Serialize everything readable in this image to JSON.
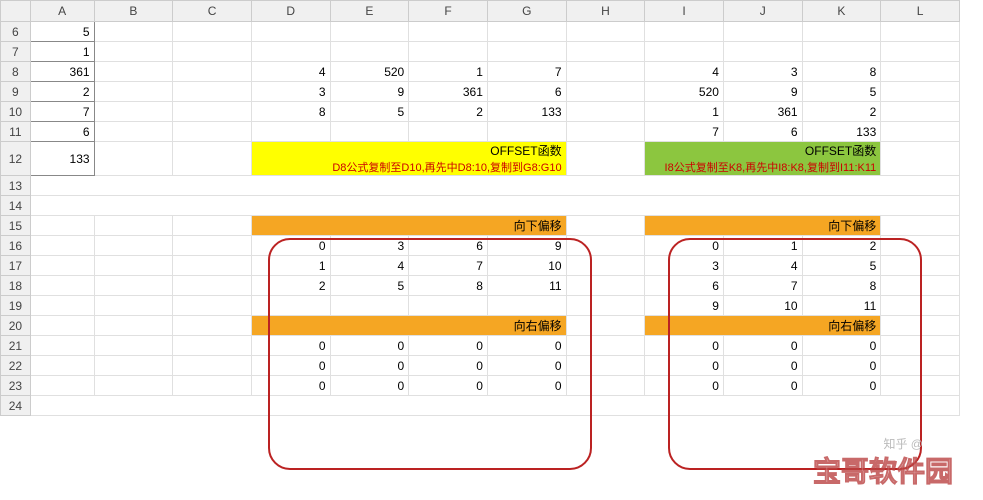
{
  "columns": [
    "A",
    "B",
    "C",
    "D",
    "E",
    "F",
    "G",
    "H",
    "I",
    "J",
    "K",
    "L"
  ],
  "rows": [
    "6",
    "7",
    "8",
    "9",
    "10",
    "11",
    "12",
    "13",
    "14",
    "15",
    "16",
    "17",
    "18",
    "19",
    "20",
    "21",
    "22",
    "23",
    "24"
  ],
  "colA": {
    "6": "5",
    "7": "1",
    "8": "361",
    "9": "2",
    "10": "7",
    "11": "6",
    "12": "133"
  },
  "gridDG": {
    "8": [
      "4",
      "520",
      "1",
      "7"
    ],
    "9": [
      "3",
      "9",
      "361",
      "6"
    ],
    "10": [
      "8",
      "5",
      "2",
      "133"
    ]
  },
  "gridIK": {
    "8": [
      "4",
      "3",
      "8"
    ],
    "9": [
      "520",
      "9",
      "5"
    ],
    "10": [
      "1",
      "361",
      "2"
    ],
    "11": [
      "7",
      "6",
      "133"
    ]
  },
  "box1": {
    "title": "OFFSET函数",
    "sub": "D8公式复制至D10,再先中D8:10,复制到G8:G10"
  },
  "box2": {
    "title": "OFFSET函数",
    "sub": "I8公式复制至K8,再先中I8:K8,复制到I11:K11"
  },
  "sec": {
    "down": "向下偏移",
    "right": "向右偏移"
  },
  "left": {
    "down": [
      [
        "0",
        "3",
        "6",
        "9"
      ],
      [
        "1",
        "4",
        "7",
        "10"
      ],
      [
        "2",
        "5",
        "8",
        "11"
      ]
    ],
    "right": [
      [
        "0",
        "0",
        "0",
        "0"
      ],
      [
        "0",
        "0",
        "0",
        "0"
      ],
      [
        "0",
        "0",
        "0",
        "0"
      ]
    ]
  },
  "right": {
    "down": [
      [
        "0",
        "1",
        "2"
      ],
      [
        "3",
        "4",
        "5"
      ],
      [
        "6",
        "7",
        "8"
      ],
      [
        "9",
        "10",
        "11"
      ]
    ],
    "right": [
      [
        "0",
        "0",
        "0"
      ],
      [
        "0",
        "0",
        "0"
      ],
      [
        "0",
        "0",
        "0"
      ]
    ]
  },
  "watermark": "宝哥软件园",
  "kn": "知乎 @"
}
